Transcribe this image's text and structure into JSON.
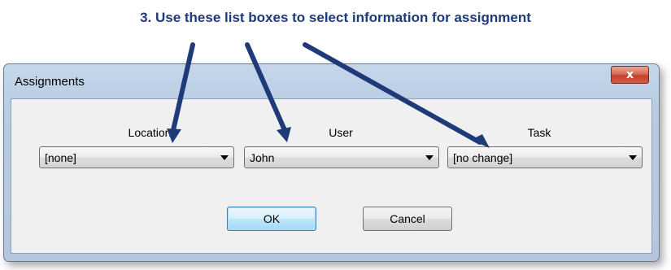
{
  "caption": "3. Use these list boxes to select information for assignment",
  "window": {
    "title": "Assignments",
    "close_glyph": "x"
  },
  "fields": [
    {
      "label": "Location",
      "value": "[none]"
    },
    {
      "label": "User",
      "value": "John"
    },
    {
      "label": "Task",
      "value": "[no change]"
    }
  ],
  "buttons": {
    "ok": "OK",
    "cancel": "Cancel"
  },
  "colors": {
    "annotation": "#1f3a78",
    "title_gradient": "#b7cbe2",
    "close": "#c2432e"
  }
}
